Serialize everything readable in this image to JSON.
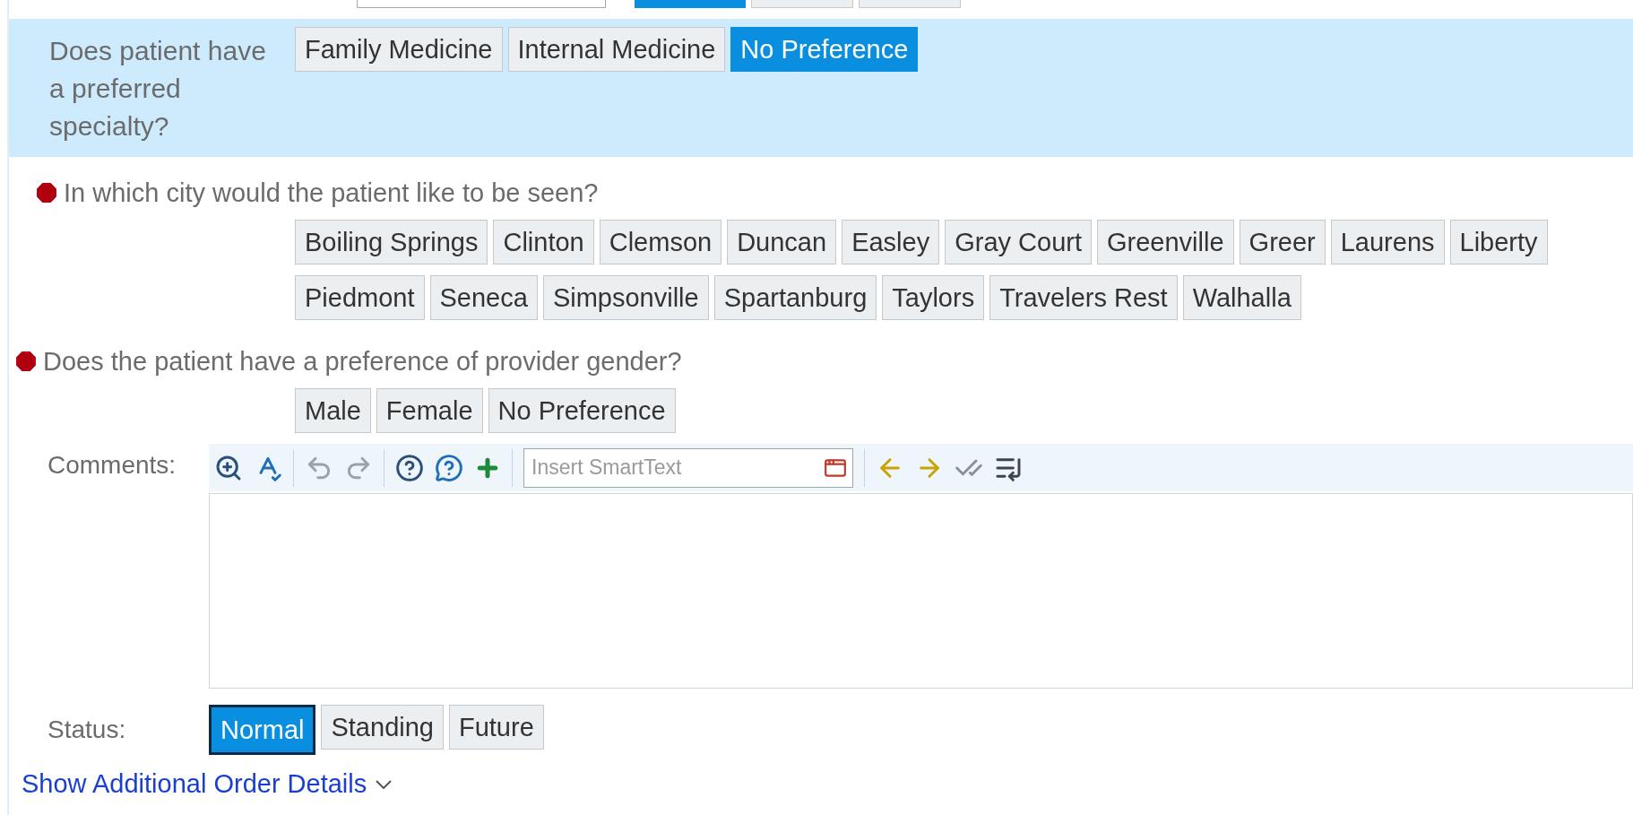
{
  "top_row": {
    "buttons": [
      {
        "selected": true
      },
      {
        "selected": false
      },
      {
        "selected": false
      }
    ]
  },
  "specialty": {
    "question": "Does patient have a preferred specialty?",
    "highlighted": true,
    "options": [
      {
        "label": "Family Medicine",
        "selected": false
      },
      {
        "label": "Internal Medicine",
        "selected": false
      },
      {
        "label": "No Preference",
        "selected": true
      }
    ]
  },
  "city": {
    "question": "In which city would the patient like to be seen?",
    "required": true,
    "options": [
      {
        "label": "Boiling Springs",
        "selected": false
      },
      {
        "label": "Clinton",
        "selected": false
      },
      {
        "label": "Clemson",
        "selected": false
      },
      {
        "label": "Duncan",
        "selected": false
      },
      {
        "label": "Easley",
        "selected": false
      },
      {
        "label": "Gray Court",
        "selected": false
      },
      {
        "label": "Greenville",
        "selected": false
      },
      {
        "label": "Greer",
        "selected": false
      },
      {
        "label": "Laurens",
        "selected": false
      },
      {
        "label": "Liberty",
        "selected": false
      },
      {
        "label": "Piedmont",
        "selected": false
      },
      {
        "label": "Seneca",
        "selected": false
      },
      {
        "label": "Simpsonville",
        "selected": false
      },
      {
        "label": "Spartanburg",
        "selected": false
      },
      {
        "label": "Taylors",
        "selected": false
      },
      {
        "label": "Travelers Rest",
        "selected": false
      },
      {
        "label": "Walhalla",
        "selected": false
      }
    ]
  },
  "gender": {
    "question": "Does the patient have a preference of provider gender?",
    "required": true,
    "options": [
      {
        "label": "Male",
        "selected": false
      },
      {
        "label": "Female",
        "selected": false
      },
      {
        "label": "No Preference",
        "selected": false
      }
    ]
  },
  "comments": {
    "label": "Comments:",
    "smarttext_placeholder": "Insert SmartText"
  },
  "status": {
    "label": "Status:",
    "options": [
      {
        "label": "Normal",
        "selected": true,
        "focused": true
      },
      {
        "label": "Standing",
        "selected": false,
        "focused": false
      },
      {
        "label": "Future",
        "selected": false,
        "focused": false
      }
    ]
  },
  "link": "Show Additional Order Details"
}
